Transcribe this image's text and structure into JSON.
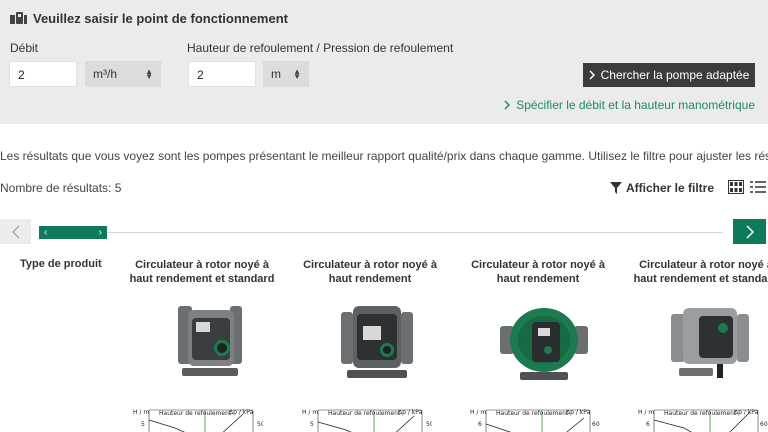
{
  "operating_point": {
    "title": "Veuillez saisir le point de fonctionnement",
    "flow_label": "Débit",
    "flow_value": "2",
    "flow_unit": "m³/h",
    "head_label": "Hauteur de refoulement / Pression de refoulement",
    "head_value": "2",
    "head_unit": "m",
    "search_button": "Chercher la pompe adaptée",
    "specify_link": "Spécifier le débit et la hauteur manométrique"
  },
  "results": {
    "info_text": "Les résultats que vous voyez sont les pompes présentant le meilleur rapport qualité/prix dans chaque gamme. Utilisez le filtre pour ajuster les résultats.",
    "count_text": "Nombre de résultats: 5",
    "filter_label": "Afficher le filtre"
  },
  "comparison": {
    "row_label": "Type de produit",
    "products": [
      {
        "name": "Circulateur à rotor noyé à haut rendement et standard"
      },
      {
        "name": "Circulateur à rotor noyé à haut rendement"
      },
      {
        "name": "Circulateur à rotor noyé à haut rendement"
      },
      {
        "name": "Circulateur à rotor noyé à haut rendement et standard"
      }
    ],
    "curve_labels": {
      "y_left": "H / m",
      "title": "Hauteur de refoulement",
      "y_right": "Δp / kPa",
      "tick_left": "6",
      "tick_left_alt": "5",
      "tick_right": "60",
      "tick_right_alt": "50"
    }
  },
  "colors": {
    "accent": "#0e7a5c",
    "panel_bg": "#ebebeb",
    "button_dark": "#3c3c3c",
    "pump_green": "#1b7a4f"
  }
}
